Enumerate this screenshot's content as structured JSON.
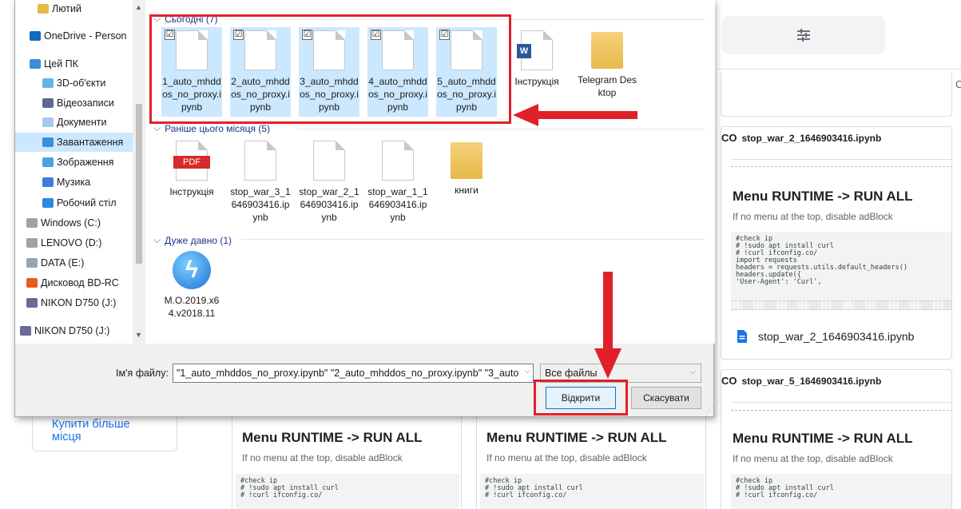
{
  "dialog": {
    "nav_items": [
      {
        "label": "Лютий",
        "icon": "folder-icon"
      },
      {
        "label": "OneDrive - Person",
        "icon": "cloud-icon"
      },
      {
        "label": "Цей ПК",
        "icon": "computer-icon"
      },
      {
        "label": "3D-об'єкти",
        "icon": "3d-objects-icon"
      },
      {
        "label": "Відеозаписи",
        "icon": "videos-icon"
      },
      {
        "label": "Документи",
        "icon": "documents-icon"
      },
      {
        "label": "Завантаження",
        "icon": "downloads-icon"
      },
      {
        "label": "Зображення",
        "icon": "pictures-icon"
      },
      {
        "label": "Музика",
        "icon": "music-icon"
      },
      {
        "label": "Робочий стіл",
        "icon": "desktop-icon"
      },
      {
        "label": "Windows (C:)",
        "icon": "drive-icon"
      },
      {
        "label": "LENOVO (D:)",
        "icon": "drive-icon"
      },
      {
        "label": "DATA (E:)",
        "icon": "drive-icon"
      },
      {
        "label": "Дисковод BD-RC",
        "icon": "optical-drive-icon"
      },
      {
        "label": "NIKON D750 (J:)",
        "icon": "sd-card-icon"
      },
      {
        "label": "NIKON D750 (J:)",
        "icon": "sd-card-icon"
      }
    ],
    "groups": [
      {
        "label": "Сьогодні (7)"
      },
      {
        "label": "Раніше цього місяця (5)"
      },
      {
        "label": "Дуже давно (1)"
      }
    ],
    "today_files": [
      {
        "name": "1_auto_mhddos_no_proxy.ipynb",
        "checked": true
      },
      {
        "name": "2_auto_mhddos_no_proxy.ipynb",
        "checked": true
      },
      {
        "name": "3_auto_mhddos_no_proxy.ipynb",
        "checked": true
      },
      {
        "name": "4_auto_mhddos_no_proxy.ipynb",
        "checked": true
      },
      {
        "name": "5_auto_mhddos_no_proxy.ipynb",
        "checked": true
      },
      {
        "name": "Інструкція",
        "icon": "word-doc-icon"
      },
      {
        "name": "Telegram Desktop",
        "icon": "folder-icon"
      }
    ],
    "month_files": [
      {
        "name": "Інструкція",
        "icon": "pdf-icon",
        "badge": "PDF"
      },
      {
        "name": "stop_war_3_1646903416.ipynb"
      },
      {
        "name": "stop_war_2_1646903416.ipynb"
      },
      {
        "name": "stop_war_1_1646903416.ipynb"
      },
      {
        "name": "книги",
        "icon": "folder-icon"
      }
    ],
    "old_files": [
      {
        "name": "M.O.2019.x64.v2018.11",
        "icon": "app-icon"
      }
    ],
    "filename_label": "Ім'я файлу:",
    "filename_value": "\"1_auto_mhddos_no_proxy.ipynb\" \"2_auto_mhddos_no_proxy.ipynb\" \"3_auto",
    "filetype_value": "Все файлы",
    "open_label": "Відкрити",
    "cancel_label": "Скасувати",
    "checkmark": "☑"
  },
  "background": {
    "buy_storage": "Купити більше місця",
    "cards": [
      {
        "title": "stop_war_2_1646903416.ipynb",
        "file_link": "stop_war_2_1646903416.ipynb"
      },
      {
        "title": "stop_war_5_1646903416.ipynb"
      }
    ],
    "runtime_title": "Menu RUNTIME -> RUN ALL",
    "runtime_sub": "If no menu at the top, disable adBlock",
    "code_lines": "#check ip\n# !sudo apt install curl\n# !curl ifconfig.co/\nimport requests\nheaders = requests.utils.default_headers()\nheaders.update({\n'User-Agent': 'Curl',\n",
    "code_lines_short": "#check ip\n# !sudo apt install curl\n# !curl ifconfig.co/",
    "colors": {
      "accent": "#1a73e8",
      "red": "#e0202a",
      "selection": "#cce8ff"
    }
  }
}
